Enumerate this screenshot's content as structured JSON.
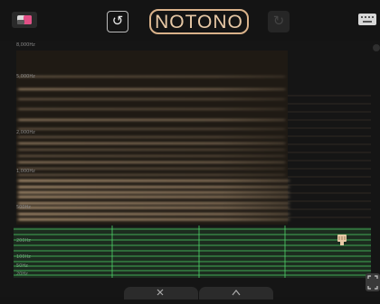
{
  "app": {
    "title": "NOTONO"
  },
  "toolbar": {
    "palette_icon": "palette-icon",
    "undo_icon": "undo-icon",
    "undo_glyph": "↺",
    "redo_icon": "redo-icon",
    "redo_glyph": "↻",
    "keyboard_icon": "keyboard-icon"
  },
  "spectrogram": {
    "frequency_labels": [
      "8,000Hz",
      "5,000Hz",
      "2,000Hz",
      "1,000Hz",
      "500Hz",
      "200Hz",
      "100Hz",
      "50Hz",
      "20Hz"
    ],
    "accent_color": "#4fd46a",
    "sound_color": "#d9b891"
  },
  "bottom": {
    "tab_left_icon": "x-icon",
    "tab_right_icon": "chevron-up-icon"
  },
  "expand": {
    "icon": "expand-icon"
  }
}
